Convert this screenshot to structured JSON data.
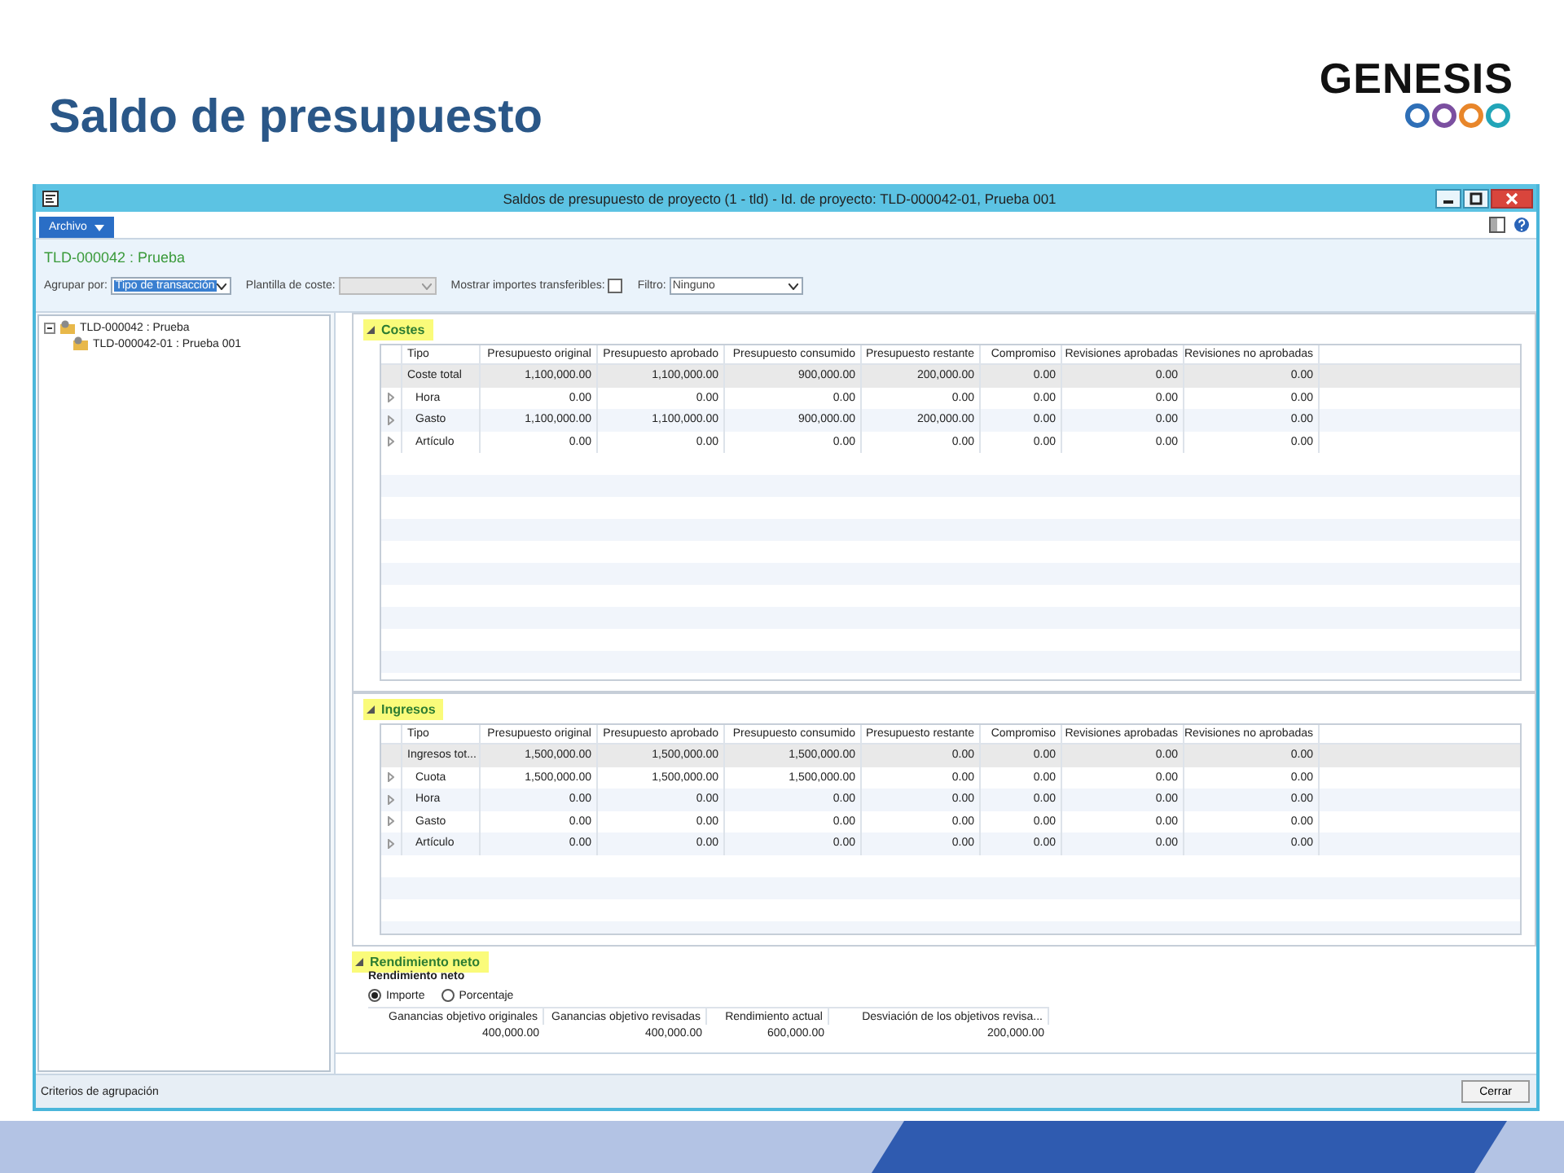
{
  "slide": {
    "title": "Saldo de presupuesto",
    "logo": "GENESIS"
  },
  "window": {
    "title": "Saldos de presupuesto de proyecto (1 - tld) - Id. de proyecto: TLD-000042-01, Prueba 001",
    "menu": "Archivo",
    "record_title": "TLD-000042 : Prueba",
    "filters": {
      "group_by": {
        "label": "Agrupar por:",
        "value": "Tipo de transacción"
      },
      "cost_template": {
        "label": "Plantilla de coste:"
      },
      "show_transferable": {
        "label": "Mostrar importes transferibles:",
        "checked": false
      },
      "filter": {
        "label": "Filtro:",
        "value": "Ninguno"
      }
    }
  },
  "tree": [
    {
      "label": "TLD-000042 : Prueba",
      "expanded": true,
      "children": [
        {
          "label": "TLD-000042-01 : Prueba 001"
        }
      ]
    }
  ],
  "sections": [
    {
      "kind": "grid",
      "title": "Costes",
      "highlighted": true,
      "expanded": true,
      "columns": [
        "Tipo",
        "Presupuesto original",
        "Presupuesto aprobado",
        "Presupuesto consumido",
        "Presupuesto restante",
        "Compromiso",
        "Revisiones aprobadas",
        "Revisiones no aprobadas"
      ],
      "rows": [
        {
          "kind": "total",
          "cells": [
            "Coste total",
            "1,100,000.00",
            "1,100,000.00",
            "900,000.00",
            "200,000.00",
            "0.00",
            "0.00",
            "0.00"
          ]
        },
        {
          "kind": "line",
          "cells": [
            "Hora",
            "0.00",
            "0.00",
            "0.00",
            "0.00",
            "0.00",
            "0.00",
            "0.00"
          ]
        },
        {
          "kind": "line",
          "cells": [
            "Gasto",
            "1,100,000.00",
            "1,100,000.00",
            "900,000.00",
            "200,000.00",
            "0.00",
            "0.00",
            "0.00"
          ]
        },
        {
          "kind": "line",
          "cells": [
            "Artículo",
            "0.00",
            "0.00",
            "0.00",
            "0.00",
            "0.00",
            "0.00",
            "0.00"
          ]
        }
      ]
    },
    {
      "kind": "grid",
      "title": "Ingresos",
      "highlighted": true,
      "expanded": true,
      "columns": [
        "Tipo",
        "Presupuesto original",
        "Presupuesto aprobado",
        "Presupuesto consumido",
        "Presupuesto restante",
        "Compromiso",
        "Revisiones aprobadas",
        "Revisiones no aprobadas"
      ],
      "rows": [
        {
          "kind": "total",
          "cells": [
            "Ingresos tot...",
            "1,500,000.00",
            "1,500,000.00",
            "1,500,000.00",
            "0.00",
            "0.00",
            "0.00",
            "0.00"
          ]
        },
        {
          "kind": "line",
          "cells": [
            "Cuota",
            "1,500,000.00",
            "1,500,000.00",
            "1,500,000.00",
            "0.00",
            "0.00",
            "0.00",
            "0.00"
          ]
        },
        {
          "kind": "line",
          "cells": [
            "Hora",
            "0.00",
            "0.00",
            "0.00",
            "0.00",
            "0.00",
            "0.00",
            "0.00"
          ]
        },
        {
          "kind": "line",
          "cells": [
            "Gasto",
            "0.00",
            "0.00",
            "0.00",
            "0.00",
            "0.00",
            "0.00",
            "0.00"
          ]
        },
        {
          "kind": "line",
          "cells": [
            "Artículo",
            "0.00",
            "0.00",
            "0.00",
            "0.00",
            "0.00",
            "0.00",
            "0.00"
          ]
        }
      ]
    },
    {
      "kind": "net",
      "title": "Rendimiento neto",
      "highlighted": true,
      "expanded": true,
      "subtitle": "Rendimiento neto",
      "radios": [
        {
          "label": "Importe",
          "selected": true
        },
        {
          "label": "Porcentaje",
          "selected": false
        }
      ],
      "columns": [
        "Ganancias objetivo originales",
        "Ganancias objetivo revisadas",
        "Rendimiento actual",
        "Desviación de los objetivos revisa..."
      ],
      "values": [
        "400,000.00",
        "400,000.00",
        "600,000.00",
        "200,000.00"
      ]
    }
  ],
  "status_bar": {
    "text": "Criterios de agrupación",
    "button": "Cerrar"
  }
}
